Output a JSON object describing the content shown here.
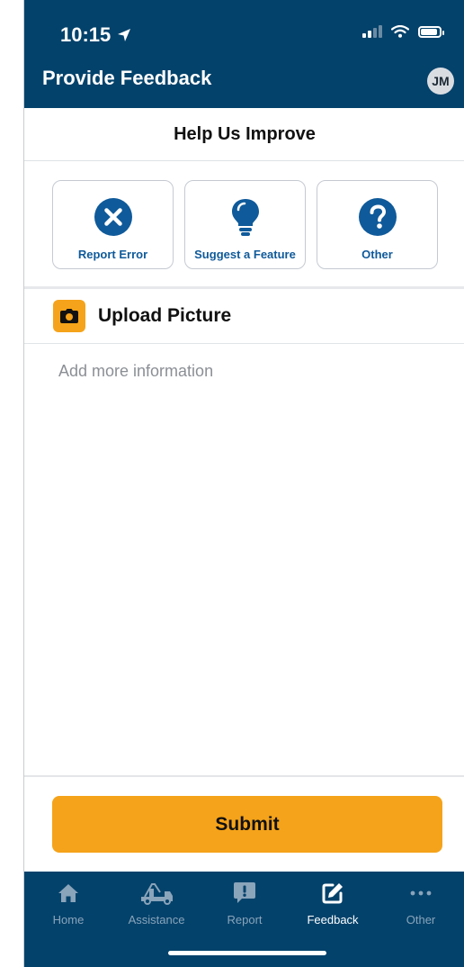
{
  "status_bar": {
    "time": "10:15"
  },
  "header": {
    "title": "Provide Feedback",
    "avatar_initials": "JM"
  },
  "section": {
    "title": "Help Us Improve"
  },
  "categories": [
    {
      "label": "Report Error",
      "icon": "x-circle-icon"
    },
    {
      "label": "Suggest a Feature",
      "icon": "lightbulb-icon"
    },
    {
      "label": "Other",
      "icon": "question-circle-icon"
    }
  ],
  "upload": {
    "label": "Upload Picture",
    "icon": "camera-icon"
  },
  "details": {
    "placeholder": "Add more information",
    "value": ""
  },
  "submit_label": "Submit",
  "tabs": [
    {
      "label": "Home",
      "icon": "home-icon",
      "active": false
    },
    {
      "label": "Assistance",
      "icon": "tow-truck-icon",
      "active": false
    },
    {
      "label": "Report",
      "icon": "exclamation-bubble-icon",
      "active": false
    },
    {
      "label": "Feedback",
      "icon": "edit-icon",
      "active": true
    },
    {
      "label": "Other",
      "icon": "more-icon",
      "active": false
    }
  ],
  "colors": {
    "header": "#03426b",
    "accent": "#f5a31a",
    "link": "#0f5a9a"
  }
}
